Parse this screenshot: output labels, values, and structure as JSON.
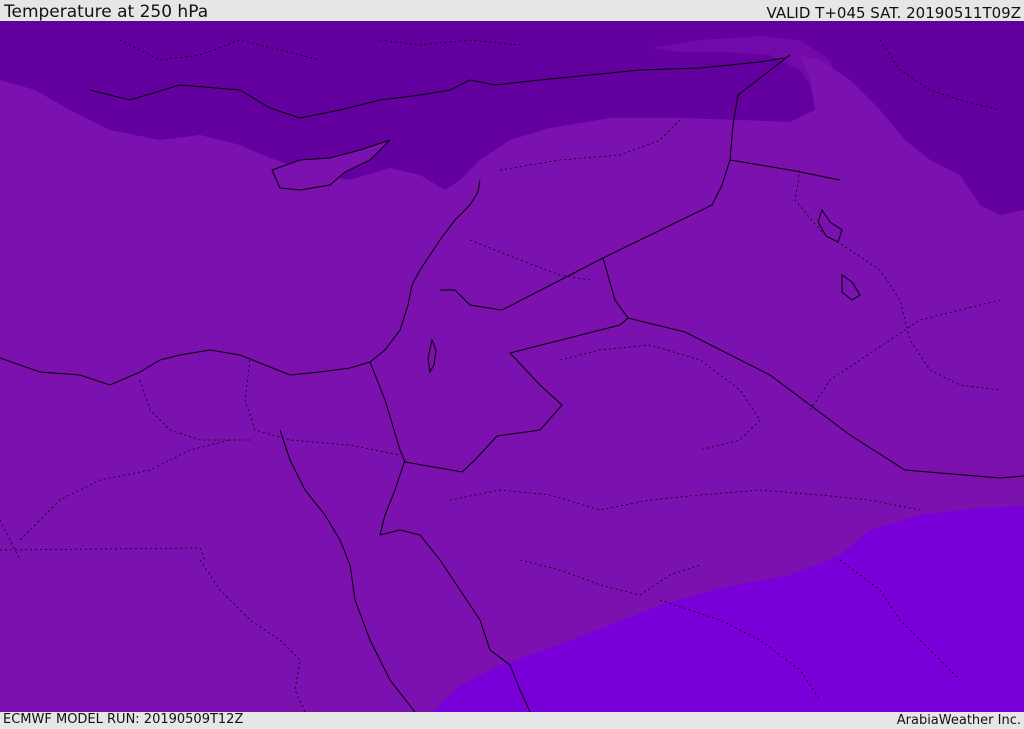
{
  "header": {
    "title": "Temperature at 250 hPa",
    "valid": "VALID T+045 SAT. 20190511T09Z"
  },
  "footer": {
    "model_run": "ECMWF MODEL RUN: 20190509T12Z",
    "credit": "ArabiaWeather Inc."
  },
  "map": {
    "colors": {
      "band_cold": "#6400a0",
      "band_mid": "#7b12b0",
      "band_warm": "#7a00d9",
      "coastline": "#000000",
      "borders": "#000000"
    }
  }
}
